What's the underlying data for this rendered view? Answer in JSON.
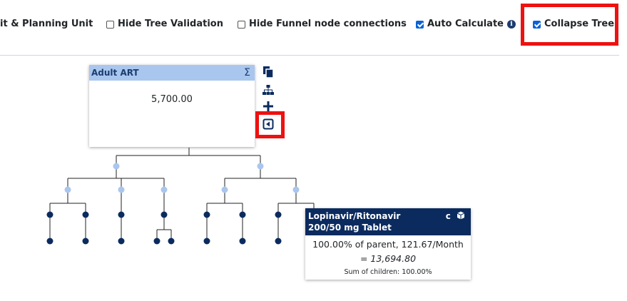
{
  "toolbar": {
    "options": [
      {
        "label": "it & Planning Unit",
        "checked": null
      },
      {
        "label": "Hide Tree Validation",
        "checked": false
      },
      {
        "label": "Hide Funnel node connections",
        "checked": false
      },
      {
        "label": "Auto Calculate",
        "checked": true
      },
      {
        "label": "Collapse Tree",
        "checked": true
      }
    ]
  },
  "root_node": {
    "title": "Adult ART",
    "sigma": "Σ",
    "value": "5,700.00"
  },
  "leaf_node": {
    "title_line1": "Lopinavir/Ritonavir",
    "title_line2": "200/50 mg Tablet",
    "badge_c": "c",
    "line1": "100.00% of parent, 121.67/Month",
    "line2": "= 13,694.80",
    "line3": "Sum of children: 100.00%"
  },
  "colors": {
    "highlight": "#ee1111",
    "node_dark": "#0b2b5f",
    "node_light": "#a9c6ef",
    "connector_dot": "#a9c6ef",
    "leaf_dot": "#0b2b5f",
    "checkbox": "#0b63d6"
  },
  "icons": {
    "copy": "copy-icon",
    "tree": "sitemap-icon",
    "add": "plus-icon",
    "collapse": "collapse-left-icon",
    "info": "info-icon",
    "cube": "cube-icon"
  }
}
